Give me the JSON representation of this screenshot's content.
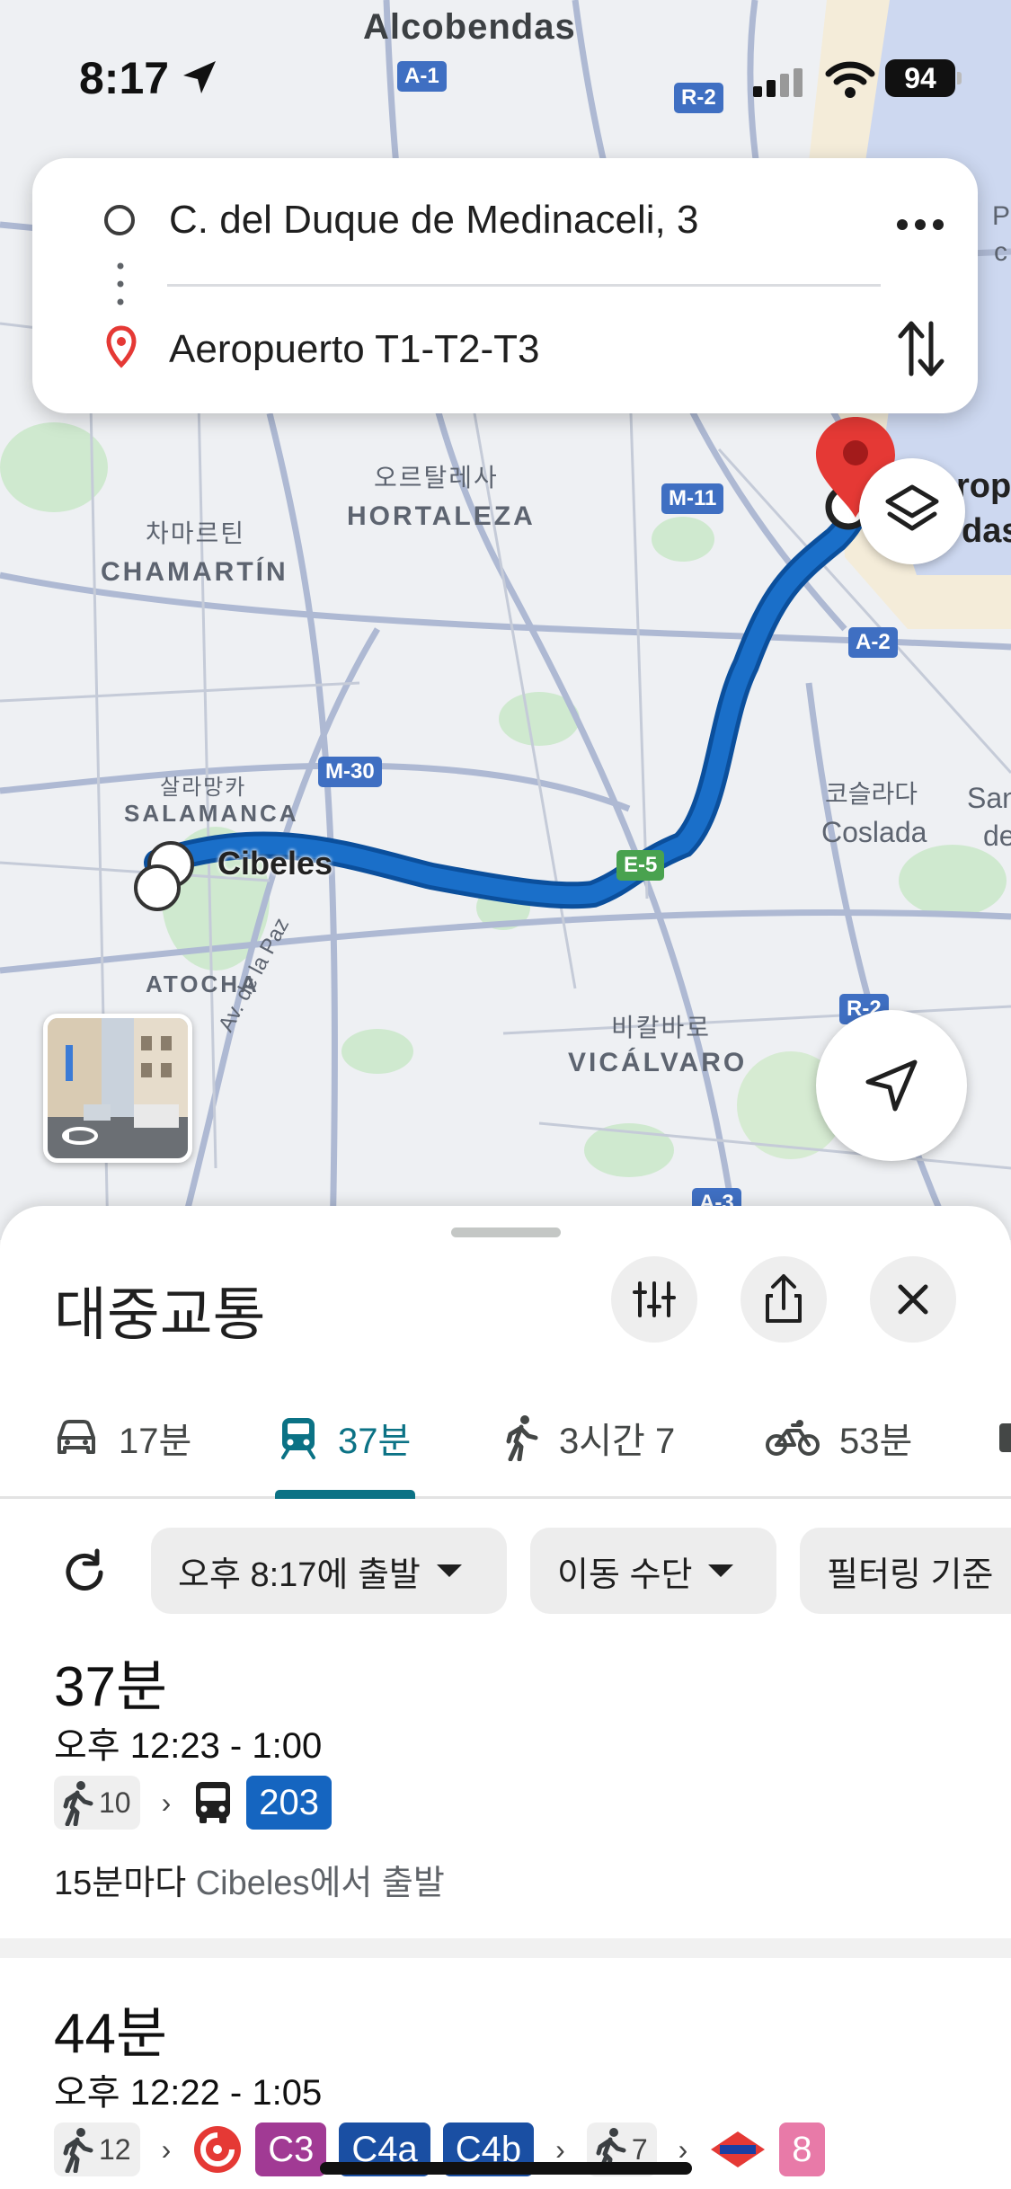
{
  "status_bar": {
    "time": "8:17",
    "battery": "94"
  },
  "map": {
    "labels": {
      "alcobendas": "Alcobendas",
      "hortaleza_ko": "오르탈레사",
      "hortaleza": "HORTALEZA",
      "chamartin_ko": "차마르틴",
      "chamartin": "CHAMARTÍN",
      "salamanca_ko": "살라망카",
      "salamanca": "SALAMANCA",
      "cibeles": "Cibeles",
      "atocha": "ATOCHA",
      "coslada_ko": "코슬라다",
      "coslada": "Coslada",
      "vicalvaro_ko": "비칼바로",
      "vicalvaro": "VICÁLVARO",
      "av_paz": "Av. de la Paz",
      "aeropuerto_partial_1": "ropu",
      "aeropuerto_partial_2": "das",
      "edge_p": "P",
      "edge_c": "c",
      "edge_san": "San",
      "edge_de": "de"
    },
    "shields": {
      "a1": "A-1",
      "r2_top": "R-2",
      "m11": "M-11",
      "a2": "A-2",
      "m30": "M-30",
      "e5": "E-5",
      "r2_bottom": "R-2",
      "a3": "A-3"
    }
  },
  "directions": {
    "origin": "C. del Duque de Medinaceli, 3",
    "destination": "Aeropuerto T1-T2-T3"
  },
  "sheet": {
    "title": "대중교통",
    "modes": [
      {
        "id": "drive",
        "label": "17분"
      },
      {
        "id": "transit",
        "label": "37분"
      },
      {
        "id": "walk",
        "label": "3시간 7"
      },
      {
        "id": "bike",
        "label": "53분"
      }
    ],
    "chips": {
      "depart": "오후 8:17에 출발",
      "modes": "이동 수단",
      "filter": "필터링 기준"
    },
    "routes": [
      {
        "duration": "37분",
        "time_range": "오후 12:23 - 1:00",
        "walk_minutes": "10",
        "lines": [
          "203"
        ],
        "freq_strong": "15분마다",
        "freq_rest": "Cibeles에서 출발"
      },
      {
        "duration": "44분",
        "time_range": "오후 12:22 - 1:05",
        "walk_minutes": "12",
        "lines": [
          "C3",
          "C4a",
          "C4b"
        ],
        "walk2_minutes": "7",
        "metro_line": "8"
      }
    ]
  },
  "colors": {
    "route_line": "#1a6fc9",
    "route_line_outline": "#0b4f9c",
    "transit_accent": "#0b7285",
    "bus_badge": "#1565c0",
    "cercanias_c3": "#a13a94",
    "cercanias_c4": "#1a4fa3",
    "metro_8": "#e87aa8",
    "pin": "#e53935"
  }
}
